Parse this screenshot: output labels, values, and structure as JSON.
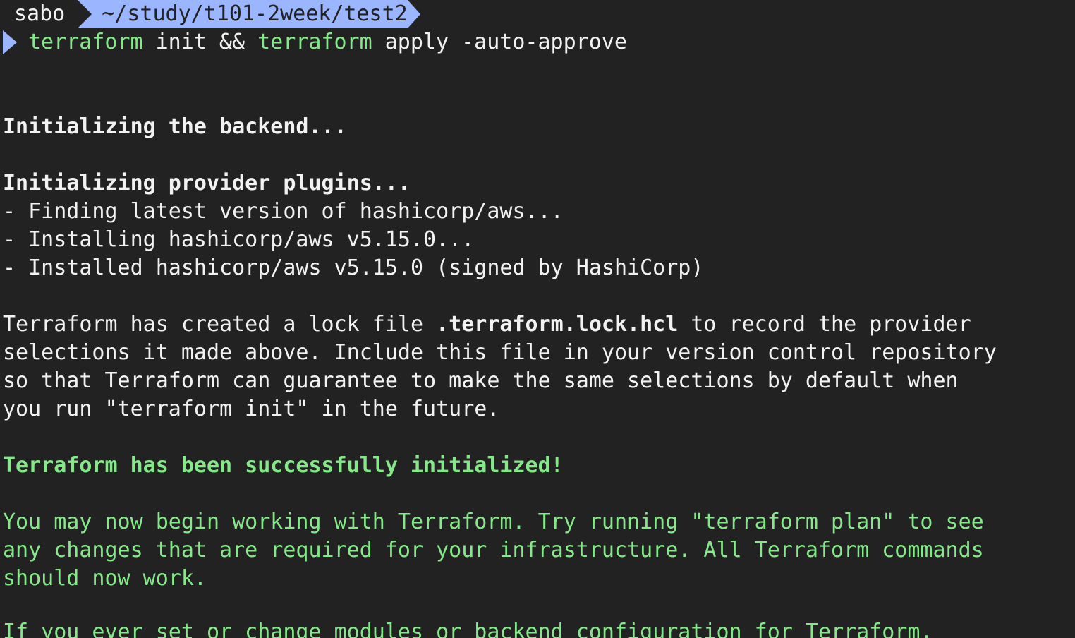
{
  "prompt": {
    "user": "sabo",
    "path": "~/study/t101-2week/test2",
    "path_color": "#9bb6ff"
  },
  "command": {
    "part1": "terraform",
    "part2": " init && ",
    "part3": "terraform",
    "part4": " apply -auto-approve"
  },
  "output": {
    "backend": "Initializing the backend...",
    "plugins": "Initializing provider plugins...",
    "finding": "- Finding latest version of hashicorp/aws...",
    "installing": "- Installing hashicorp/aws v5.15.0...",
    "installed": "- Installed hashicorp/aws v5.15.0 (signed by HashiCorp)",
    "lock_line1_a": "Terraform has created a lock file ",
    "lock_line1_b": ".terraform.lock.hcl",
    "lock_line1_c": " to record the provider",
    "lock_line2": "selections it made above. Include this file in your version control repository",
    "lock_line3": "so that Terraform can guarantee to make the same selections by default when",
    "lock_line4": "you run \"terraform init\" in the future.",
    "success": "Terraform has been successfully initialized!",
    "may_line1": "You may now begin working with Terraform. Try running \"terraform plan\" to see",
    "may_line2": "any changes that are required for your infrastructure. All Terraform commands",
    "may_line3": "should now work.",
    "partial": "If you ever set or change modules or backend configuration for Terraform,"
  },
  "colors": {
    "background": "#222222",
    "text": "#f2f2f2",
    "green": "#86e88a",
    "accent": "#9bb6ff"
  }
}
